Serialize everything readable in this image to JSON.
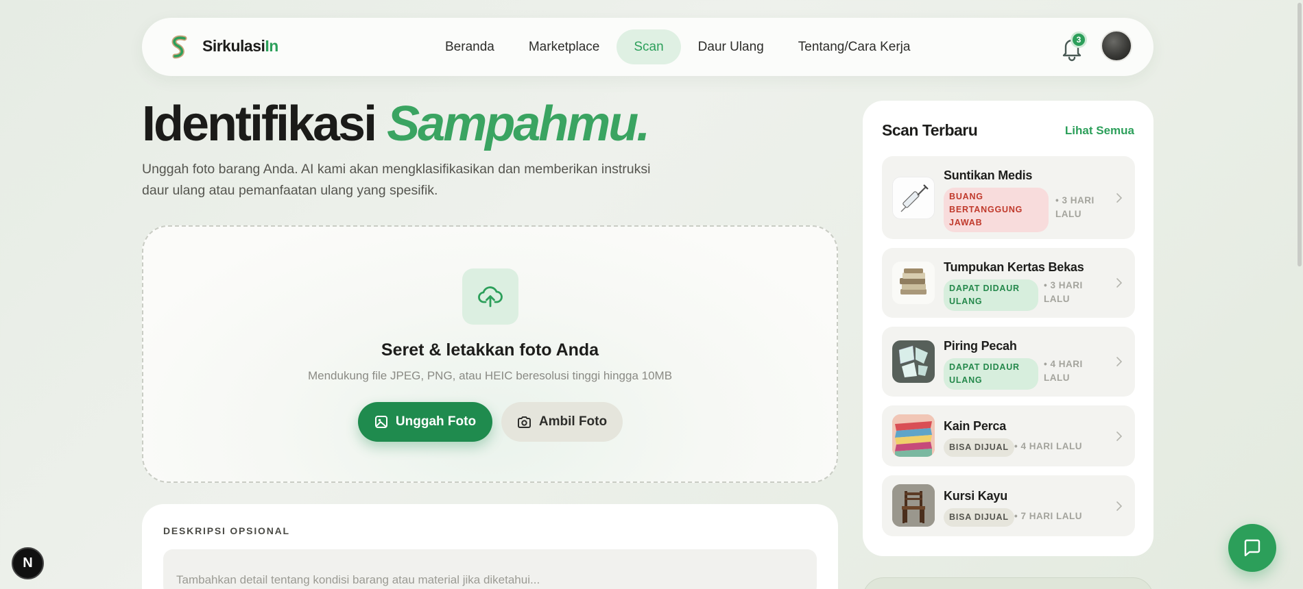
{
  "brand": {
    "name_main": "Sirkulasi",
    "name_accent": "In"
  },
  "nav": {
    "items": [
      {
        "label": "Beranda",
        "active": false
      },
      {
        "label": "Marketplace",
        "active": false
      },
      {
        "label": "Scan",
        "active": true
      },
      {
        "label": "Daur Ulang",
        "active": false
      },
      {
        "label": "Tentang/Cara Kerja",
        "active": false
      }
    ],
    "notification_count": "3"
  },
  "hero": {
    "title_main": "Identifikasi",
    "title_accent": "Sampahmu.",
    "subtitle": "Unggah foto barang Anda. AI kami akan mengklasifikasikan dan memberikan instruksi daur ulang atau pemanfaatan ulang yang spesifik."
  },
  "upload": {
    "title": "Seret & letakkan foto Anda",
    "hint": "Mendukung file JPEG, PNG, atau HEIC beresolusi tinggi hingga 10MB",
    "upload_label": "Unggah Foto",
    "camera_label": "Ambil Foto"
  },
  "description": {
    "label": "DESKRIPSI OPSIONAL",
    "placeholder": "Tambahkan detail tentang kondisi barang atau material jika diketahui..."
  },
  "recent": {
    "title": "Scan Terbaru",
    "see_all": "Lihat Semua",
    "items": [
      {
        "name": "Suntikan Medis",
        "badge": "BUANG BERTANGGUNG JAWAB",
        "badge_type": "red",
        "time": "• 3 HARI LALU"
      },
      {
        "name": "Tumpukan Kertas Bekas",
        "badge": "DAPAT DIDAUR ULANG",
        "badge_type": "green",
        "time": "• 3 HARI LALU"
      },
      {
        "name": "Piring Pecah",
        "badge": "DAPAT DIDAUR ULANG",
        "badge_type": "green",
        "time": "• 4 HARI LALU"
      },
      {
        "name": "Kain Perca",
        "badge": "BISA DIJUAL",
        "badge_type": "grey",
        "time": "• 4 HARI LALU"
      },
      {
        "name": "Kursi Kayu",
        "badge": "BISA DIJUAL",
        "badge_type": "grey",
        "time": "• 7 HARI LALU"
      }
    ]
  },
  "dev_badge": "N",
  "colors": {
    "accent": "#2c9f5a",
    "accent_dark": "#1f8b4e",
    "danger": "#c0392b"
  }
}
